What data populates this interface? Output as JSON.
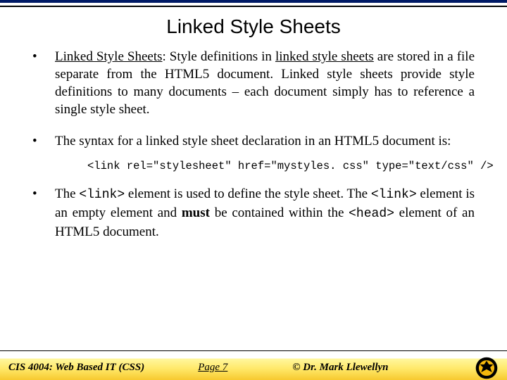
{
  "title": "Linked Style Sheets",
  "bullets": {
    "p1_lead": "Linked Style Sheets",
    "p1_a": ": Style definitions in ",
    "p1_linked": "linked style sheets",
    "p1_b": " are stored in a file separate from the HTML5 document. Linked style sheets provide style definitions to many documents – each document simply has to reference a single style sheet.",
    "p2": "The syntax for a linked style sheet declaration in an HTML5 document is:",
    "code": "<link rel=\"stylesheet\" href=\"mystyles. css\" type=\"text/css\" />",
    "p3_a": "The ",
    "p3_code1": "<link>",
    "p3_b": " element is used to define the style sheet.  The ",
    "p3_code2": "<link>",
    "p3_c": " element is an empty element and ",
    "p3_bold": "must",
    "p3_d": " be contained within the ",
    "p3_code3": "<head>",
    "p3_e": " element of an HTML5 document."
  },
  "footer": {
    "course": "CIS 4004: Web Based IT (CSS)",
    "page": "Page 7",
    "copyright": "© Dr. Mark Llewellyn"
  }
}
